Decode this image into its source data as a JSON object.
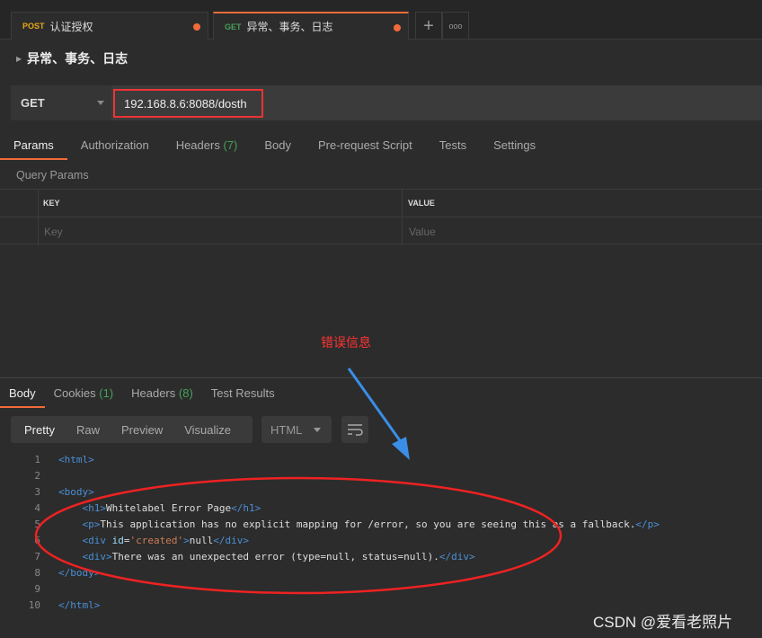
{
  "tabs": [
    {
      "method": "POST",
      "method_color": "#e6a817",
      "label": "认证授权",
      "unsaved": true
    },
    {
      "method": "GET",
      "method_color": "#47a05a",
      "label": "异常、事务、日志",
      "unsaved": true,
      "active": true
    }
  ],
  "new_tab": "+",
  "more_tabs": "ooo",
  "request_title": "异常、事务、日志",
  "method": "GET",
  "url": "192.168.8.6:8088/dosth",
  "request_tabs": {
    "params": "Params",
    "authorization": "Authorization",
    "headers": "Headers",
    "headers_count": "(7)",
    "body": "Body",
    "prerequest": "Pre-request Script",
    "tests": "Tests",
    "settings": "Settings"
  },
  "query_params": {
    "label": "Query Params",
    "key_header": "KEY",
    "value_header": "VALUE",
    "key_placeholder": "Key",
    "value_placeholder": "Value"
  },
  "response_tabs": {
    "body": "Body",
    "cookies": "Cookies",
    "cookies_count": "(1)",
    "headers": "Headers",
    "headers_count": "(8)",
    "test_results": "Test Results"
  },
  "view_modes": {
    "pretty": "Pretty",
    "raw": "Raw",
    "preview": "Preview",
    "visualize": "Visualize"
  },
  "language": "HTML",
  "code_lines": [
    [
      [
        "tag",
        "<html>"
      ]
    ],
    [],
    [
      [
        "tag",
        "<body>"
      ]
    ],
    [
      [
        "txt",
        "    "
      ],
      [
        "tag",
        "<h1>"
      ],
      [
        "txt",
        "Whitelabel Error Page"
      ],
      [
        "tag",
        "</h1>"
      ]
    ],
    [
      [
        "txt",
        "    "
      ],
      [
        "tag",
        "<p>"
      ],
      [
        "txt",
        "This application has no explicit mapping for /error, so you are seeing this as a fallback."
      ],
      [
        "tag",
        "</p>"
      ]
    ],
    [
      [
        "txt",
        "    "
      ],
      [
        "tag",
        "<div "
      ],
      [
        "attr",
        "id"
      ],
      [
        "txt",
        "="
      ],
      [
        "str",
        "'created'"
      ],
      [
        "tag",
        ">"
      ],
      [
        "txt",
        "null"
      ],
      [
        "tag",
        "</div>"
      ]
    ],
    [
      [
        "txt",
        "    "
      ],
      [
        "tag",
        "<div>"
      ],
      [
        "txt",
        "There was an unexpected error (type=null, status=null)."
      ],
      [
        "tag",
        "</div>"
      ]
    ],
    [
      [
        "tag",
        "</body>"
      ]
    ],
    [],
    [
      [
        "tag",
        "</html>"
      ]
    ]
  ],
  "annotation": "错误信息",
  "watermark": "CSDN @爱看老照片"
}
